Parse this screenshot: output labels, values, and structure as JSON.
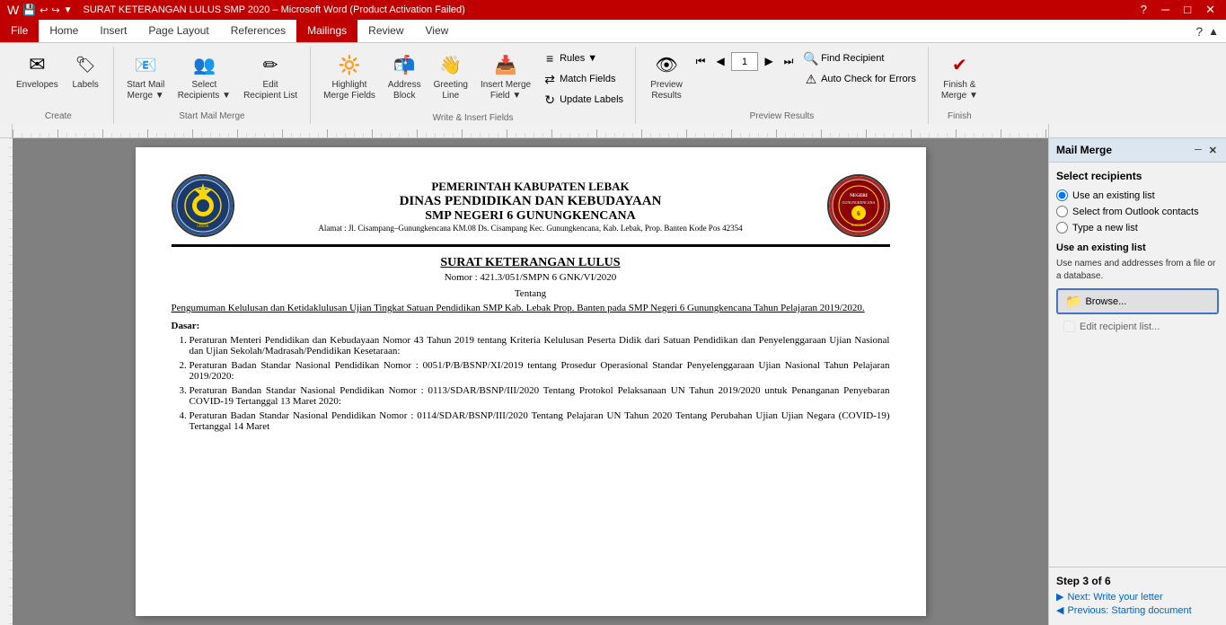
{
  "titleBar": {
    "title": "SURAT KETERANGAN LULUS SMP 2020 – Microsoft Word (Product Activation Failed)",
    "minimize": "─",
    "maximize": "□",
    "close": "✕"
  },
  "tabs": [
    {
      "label": "File",
      "active": false,
      "isFile": true
    },
    {
      "label": "Home",
      "active": false
    },
    {
      "label": "Insert",
      "active": false
    },
    {
      "label": "Page Layout",
      "active": false
    },
    {
      "label": "References",
      "active": false
    },
    {
      "label": "Mailings",
      "active": true
    },
    {
      "label": "Review",
      "active": false
    },
    {
      "label": "View",
      "active": false
    }
  ],
  "ribbon": {
    "groups": [
      {
        "label": "Create",
        "items": [
          {
            "type": "button",
            "icon": "✉",
            "label": "Envelopes",
            "name": "envelopes-button"
          },
          {
            "type": "button",
            "icon": "🏷",
            "label": "Labels",
            "name": "labels-button"
          }
        ]
      },
      {
        "label": "Start Mail Merge",
        "items": [
          {
            "type": "button",
            "icon": "📧",
            "label": "Start Mail Merge ▼",
            "name": "start-mail-merge-button"
          },
          {
            "type": "button",
            "icon": "👥",
            "label": "Select Recipients ▼",
            "name": "select-recipients-button"
          },
          {
            "type": "button",
            "icon": "✏",
            "label": "Edit Recipient List",
            "name": "edit-recipient-list-button"
          }
        ]
      },
      {
        "label": "Write & Insert Fields",
        "items": [
          {
            "type": "button",
            "icon": "🔆",
            "label": "Highlight Merge Fields",
            "name": "highlight-merge-fields-button"
          },
          {
            "type": "button",
            "icon": "📬",
            "label": "Address Block",
            "name": "address-block-button"
          },
          {
            "type": "button",
            "icon": "👋",
            "label": "Greeting Line",
            "name": "greeting-line-button"
          },
          {
            "type": "button",
            "icon": "📥",
            "label": "Insert Merge Field ▼",
            "name": "insert-merge-field-button"
          },
          {
            "type": "col",
            "items": [
              {
                "icon": "≡",
                "label": "Rules ▼",
                "name": "rules-button"
              },
              {
                "icon": "⇄",
                "label": "Match Fields",
                "name": "match-fields-button"
              },
              {
                "icon": "↻",
                "label": "Update Labels",
                "name": "update-labels-button"
              }
            ]
          }
        ]
      },
      {
        "label": "Preview Results",
        "items": [
          {
            "type": "button",
            "icon": "👁",
            "label": "Preview Results",
            "name": "preview-results-button"
          },
          {
            "type": "col",
            "items": [
              {
                "icon": "◀",
                "label": "",
                "name": "prev-record-button"
              },
              {
                "icon": "◀◀",
                "label": "",
                "name": "first-record-button"
              },
              {
                "icon": "▶",
                "label": "",
                "name": "next-record-button"
              },
              {
                "icon": "▶▶",
                "label": "",
                "name": "last-record-button"
              }
            ]
          },
          {
            "type": "col",
            "items": [
              {
                "icon": "🔍",
                "label": "Find Recipient",
                "name": "find-recipient-button"
              },
              {
                "icon": "⚠",
                "label": "Auto Check for Errors",
                "name": "auto-check-errors-button"
              }
            ]
          }
        ]
      },
      {
        "label": "Finish",
        "items": [
          {
            "type": "button",
            "icon": "✔",
            "label": "Finish & Merge ▼",
            "name": "finish-merge-button"
          }
        ]
      }
    ]
  },
  "document": {
    "header": {
      "dept1": "PEMERINTAH KABUPATEN LEBAK",
      "dept2": "DINAS PENDIDIKAN DAN KEBUDAYAAN",
      "dept3": "SMP NEGERI 6 GUNUNGKENCANA",
      "address": "Alamat : Jl. Cisampang–Gunungkencana KM.08 Ds. Cisampang Kec. Gunungkencana, Kab. Lebak, Prop. Banten Kode Pos 42354"
    },
    "title": "SURAT KETERANGAN LULUS",
    "subtitle": "Nomor : 421.3/051/SMPN 6 GNK/VI/2020",
    "tentang": "Tentang",
    "pengumuman": "Pengumuman Kelulusan dan Ketidaklulusan Ujian Tingkat Satuan Pendidikan SMP Kab. Lebak Prop. Banten pada SMP Negeri 6 Gunungkencana Tahun Pelajaran 2019/2020.",
    "dasar": "Dasar:",
    "list": [
      "Peraturan Menteri Pendidikan dan Kebudayaan Nomor 43 Tahun 2019 tentang Kriteria Kelulusan Peserta Didik dari Satuan Pendidikan dan Penyelenggaraan Ujian Nasional dan Ujian Sekolah/Madrasah/Pendidikan Kesetaraan:",
      "Peraturan Badan Standar Nasional Pendidikan Nomor : 0051/P/B/BSNP/XI/2019 tentang Prosedur Operasional Standar Penyelenggaraan Ujian Nasional Tahun Pelajaran 2019/2020:",
      "Peraturan Bandan Standar Nasional Pendidikan Nomor : 0113/SDAR/BSNP/III/2020 Tentang Protokol Pelaksanaan UN Tahun 2019/2020 untuk Penanganan Penyebaran COVID-19 Tertanggal 13 Maret 2020:",
      "Peraturan Badan Standar Nasional Pendidikan Nomor : 0114/SDAR/BSNP/III/2020 Tentang Pelajaran UN Tahun 2020 Tentang Perubahan Ujian Ujian Negara (COVID-19) Tertanggal 14 Maret"
    ]
  },
  "mailMerge": {
    "title": "Mail Merge",
    "selectRecipientsTitle": "Select recipients",
    "options": [
      {
        "label": "Use an existing list",
        "name": "use-existing-list",
        "checked": true
      },
      {
        "label": "Select from Outlook contacts",
        "name": "select-outlook",
        "checked": false
      },
      {
        "label": "Type a new list",
        "name": "type-new-list",
        "checked": false
      }
    ],
    "subsectionTitle": "Use an existing list",
    "subsectionDesc": "Use names and addresses from a file or a database.",
    "browseLabel": "Browse...",
    "editListLabel": "Edit recipient list...",
    "step": {
      "indicator": "Step 3 of 6",
      "nextLabel": "Next: Write your letter",
      "prevLabel": "Previous: Starting document"
    }
  }
}
